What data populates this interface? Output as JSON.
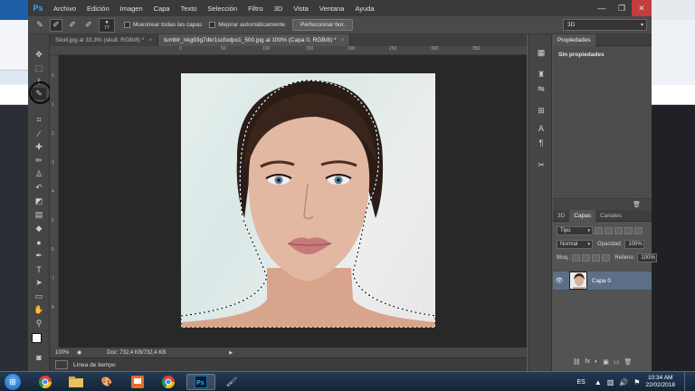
{
  "app": {
    "logo": "Ps",
    "menu": [
      "Archivo",
      "Edición",
      "Imagen",
      "Capa",
      "Texto",
      "Selección",
      "Filtro",
      "3D",
      "Vista",
      "Ventana",
      "Ayuda"
    ],
    "window_controls": [
      "—",
      "❐",
      "✕"
    ]
  },
  "options_bar": {
    "brush_size": "77",
    "sample_all_layers_label": "Muestrear todas las capas",
    "auto_enhance_label": "Mejorar automáticamente",
    "refine_edge_button": "Perfeccionar bor.",
    "workspace": "3D"
  },
  "tabs": [
    {
      "label": "Skull.jpg al 33,3% (skull, RGB/8) *",
      "active": false
    },
    {
      "label": "tumblr_nkg93g7dkr1scfodpo1_500.jpg al 100% (Capa 0, RGB/8) *",
      "active": true
    }
  ],
  "ruler": {
    "top": [
      "0",
      "50",
      "100",
      "150",
      "200",
      "250",
      "300",
      "350",
      "400",
      "450"
    ],
    "left": [
      "0",
      "1",
      "2",
      "3",
      "4",
      "5",
      "6",
      "7",
      "8",
      "9"
    ]
  },
  "status": {
    "zoom": "100%",
    "doc": "Doc: 732,4 KB/732,4 KB"
  },
  "timeline_label": "Línea de tiempo",
  "properties": {
    "tab": "Propiedades",
    "title": "Sin propiedades"
  },
  "layers": {
    "tabs": [
      "3D",
      "Capas",
      "Canales"
    ],
    "filter": "Tipo",
    "blend_mode": "Normal",
    "opacity_label": "Opacidad:",
    "opacity": "100%",
    "lock_label": "Bloq.:",
    "fill_label": "Relleno:",
    "fill": "100%",
    "items": [
      {
        "name": "Capa 0",
        "visible": true
      }
    ],
    "footer_icons": [
      "⛓",
      "fx",
      "◐",
      "▣",
      "▭",
      "🗑"
    ]
  },
  "taskbar": {
    "lang": "ES",
    "time": "10:34 AM",
    "date": "22/02/2018"
  }
}
